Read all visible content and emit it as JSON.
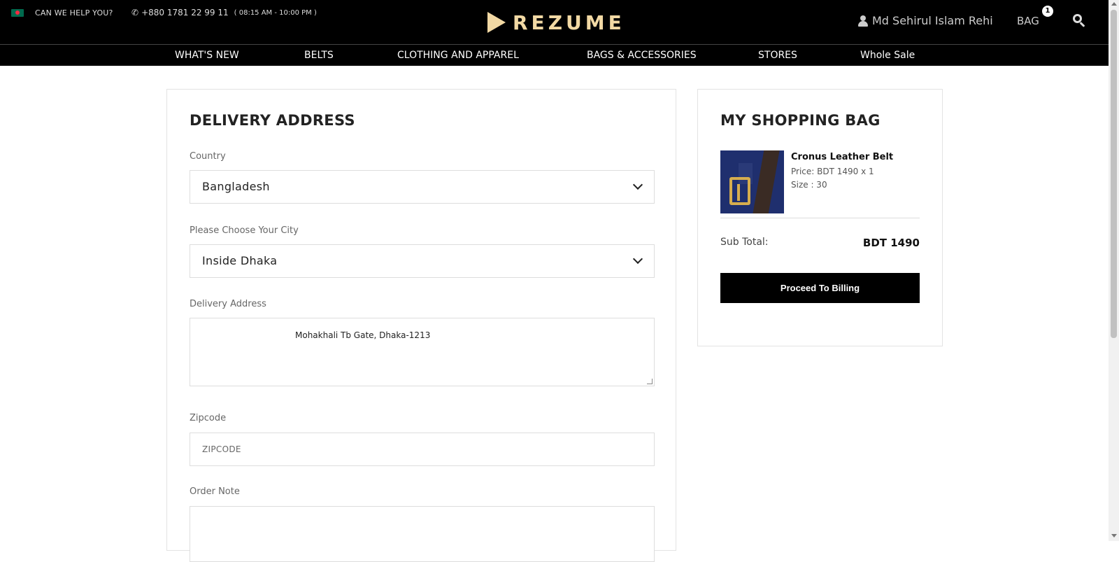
{
  "topbar": {
    "help_text": "CAN WE HELP YOU?",
    "phone": "+880 1781 22 99 11",
    "hours": "( 08:15 AM - 10:00 PM )",
    "phone_icon": "phone-icon",
    "flag_icon": "bangladesh-flag-icon"
  },
  "logo": {
    "text": "REZUME",
    "color": "#f2d9a4"
  },
  "user": {
    "name": "Md Sehirul Islam Rehi"
  },
  "bag": {
    "label": "BAG",
    "count": "1"
  },
  "nav": {
    "items": [
      {
        "label": "WHAT'S NEW"
      },
      {
        "label": "BELTS"
      },
      {
        "label": "CLOTHING AND APPAREL"
      },
      {
        "label": "BAGS & ACCESSORIES"
      },
      {
        "label": "STORES"
      },
      {
        "label": "Whole Sale"
      }
    ]
  },
  "delivery": {
    "title": "DELIVERY ADDRESS",
    "country_label": "Country",
    "country_value": "Bangladesh",
    "city_label": "Please Choose Your City",
    "city_value": "Inside Dhaka",
    "address_label": "Delivery Address",
    "address_value": "Mohakhali Tb Gate, Dhaka-1213",
    "zip_label": "Zipcode",
    "zip_placeholder": "ZIPCODE",
    "note_label": "Order Note"
  },
  "shopping_bag": {
    "title": "MY SHOPPING BAG",
    "item": {
      "name": "Cronus Leather Belt",
      "price": "Price: BDT 1490 x 1",
      "size": "Size : 30"
    },
    "subtotal_label": "Sub Total:",
    "subtotal_value": "BDT 1490",
    "proceed_label": "Proceed To Billing"
  }
}
